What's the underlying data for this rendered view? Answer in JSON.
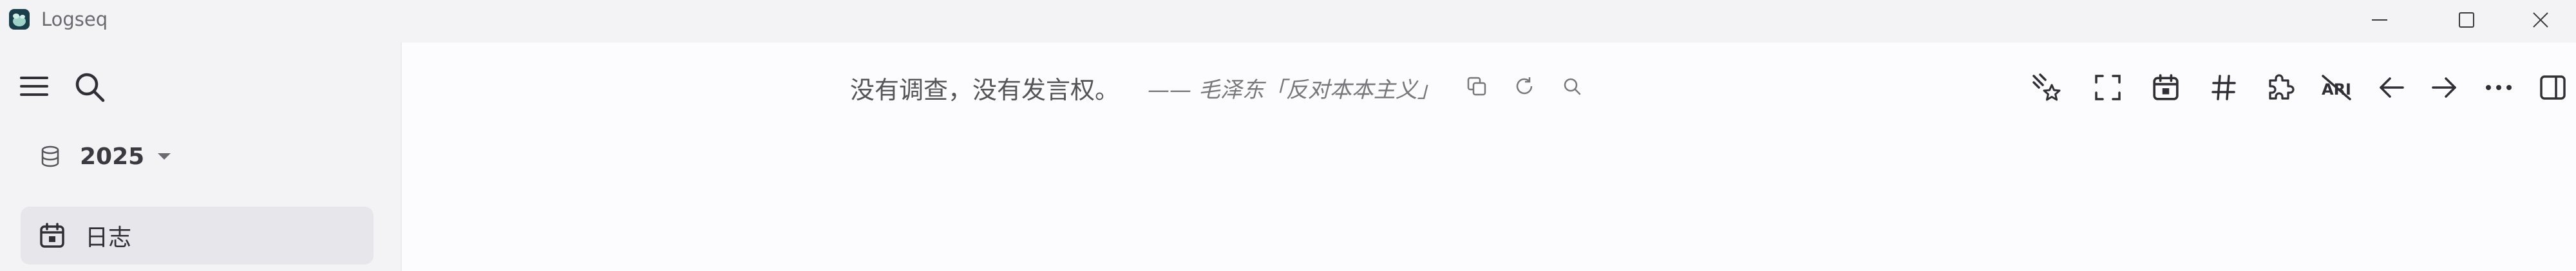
{
  "window": {
    "title": "Logseq",
    "controls": {
      "minimize": "minimize-icon",
      "maximize": "maximize-icon",
      "close": "close-icon"
    }
  },
  "sidebar": {
    "graph": {
      "name": "2025",
      "icon": "database-icon"
    },
    "nav_items": [
      {
        "label": "日志",
        "icon": "calendar-icon",
        "active": true
      }
    ]
  },
  "header": {
    "quote": {
      "text": "没有调查，没有发言权。",
      "author": "—— 毛泽东「反对本本主义」"
    },
    "toolbar_icons": [
      "sparkles-star-icon",
      "fullscreen-icon",
      "calendar-icon",
      "hashtag-icon",
      "puzzle-icon",
      "rtl-disabled-icon",
      "arrow-left-icon",
      "arrow-right-icon",
      "more-icon",
      "sidebar-toggle-icon"
    ]
  },
  "colors": {
    "sidebar_bg": "#f3f2f5",
    "main_bg": "#fcfbfd",
    "active_item_bg": "#e7e6ea",
    "logo_bg": "#1b3f4a"
  }
}
